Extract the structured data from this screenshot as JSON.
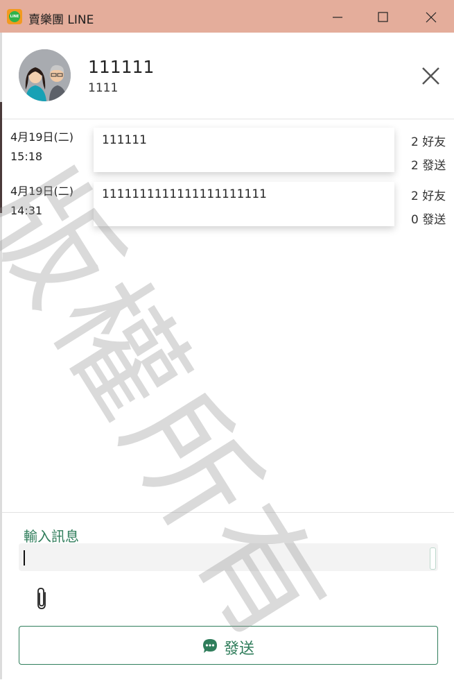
{
  "window": {
    "title": "賣樂團 LINE",
    "app_icon_text": "LINE"
  },
  "contact": {
    "name": "111111",
    "subtitle": "1111"
  },
  "messages": [
    {
      "date": "4月19日(二)",
      "time": "15:18",
      "text": "111111",
      "friends": "2 好友",
      "sent": "2 發送"
    },
    {
      "date": "4月19日(二)",
      "time": "14:31",
      "text": "1111111111111111111111",
      "friends": "2 好友",
      "sent": "0 發送"
    }
  ],
  "watermark": "版權所有",
  "composer": {
    "label": "輸入訊息",
    "value": "",
    "send_label": "發送"
  },
  "colors": {
    "titlebar": "#e4ad9b",
    "accent": "#2f7d5b"
  },
  "icons": {
    "minimize": "minimize-icon",
    "maximize": "maximize-icon",
    "close": "close-icon",
    "attach": "paperclip-icon",
    "send": "chat-bubble-icon"
  }
}
